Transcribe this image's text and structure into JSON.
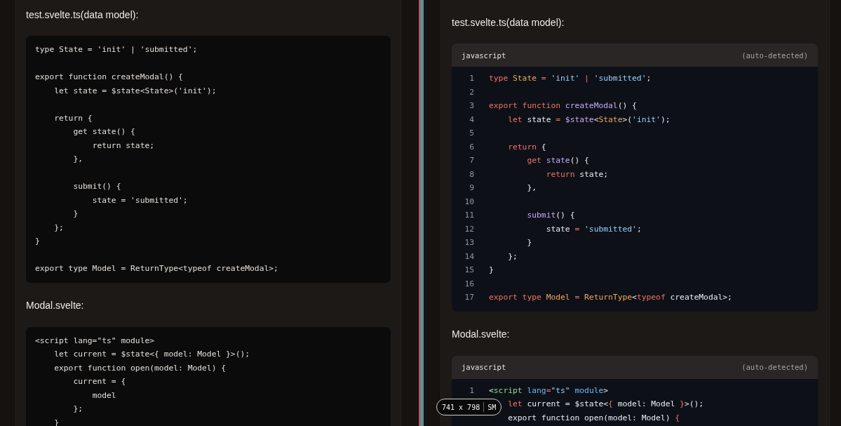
{
  "left_pane": {
    "sections": [
      {
        "heading": "test.svelte.ts(data model):",
        "code": {
          "paragraphs": [
            [
              "type State = 'init' | 'submitted';"
            ],
            [
              "export function createModal() {",
              "    let state = $state<State>('init');"
            ],
            [
              "    return {",
              "        get state() {",
              "            return state;",
              "        },"
            ],
            [
              "        submit() {",
              "            state = 'submitted';",
              "        }",
              "    };",
              "}"
            ],
            [
              "export type Model = ReturnType<typeof createModal>;"
            ]
          ]
        }
      },
      {
        "heading": "Modal.svelte:",
        "code": {
          "paragraphs": [
            [
              "<script lang=\"ts\" module>",
              "    let current = $state<{ model: Model }>();",
              "    export function open(model: Model) {",
              "        current = {",
              "            model",
              "        };",
              "    }"
            ]
          ]
        }
      }
    ]
  },
  "right_pane": {
    "sections": [
      {
        "heading": "test.svelte.ts(data model):",
        "code": {
          "language": "javascript",
          "detection": "(auto-detected)",
          "lines": [
            {
              "number": "1",
              "tokens": [
                {
                  "text": "type ",
                  "kind": "keyword"
                },
                {
                  "text": "State",
                  "kind": "type"
                },
                {
                  "text": " = ",
                  "kind": "operator"
                },
                {
                  "text": "'init'",
                  "kind": "string"
                },
                {
                  "text": " | ",
                  "kind": "operator"
                },
                {
                  "text": "'submitted'",
                  "kind": "string"
                },
                {
                  "text": ";"
                }
              ]
            },
            {
              "number": "2"
            },
            {
              "number": "3",
              "tokens": [
                {
                  "text": "export function ",
                  "kind": "keyword"
                },
                {
                  "text": "createModal",
                  "kind": "function"
                },
                {
                  "text": "() {"
                }
              ]
            },
            {
              "number": "4",
              "tokens": [
                {
                  "text": "    let",
                  "kind": "keyword"
                },
                {
                  "text": " state"
                },
                {
                  "text": " = ",
                  "kind": "operator"
                },
                {
                  "text": "$state",
                  "kind": "function"
                },
                {
                  "text": "<"
                },
                {
                  "text": "State",
                  "kind": "type"
                },
                {
                  "text": ">("
                },
                {
                  "text": "'init'",
                  "kind": "string"
                },
                {
                  "text": ");"
                }
              ]
            },
            {
              "number": "5"
            },
            {
              "number": "6",
              "tokens": [
                {
                  "text": "    return",
                  "kind": "keyword"
                },
                {
                  "text": " {"
                }
              ]
            },
            {
              "number": "7",
              "tokens": [
                {
                  "text": "        get ",
                  "kind": "keyword"
                },
                {
                  "text": "state",
                  "kind": "function"
                },
                {
                  "text": "() {"
                }
              ]
            },
            {
              "number": "8",
              "tokens": [
                {
                  "text": "            return",
                  "kind": "keyword"
                },
                {
                  "text": " state;"
                }
              ]
            },
            {
              "number": "9",
              "tokens": [
                {
                  "text": "        },"
                }
              ]
            },
            {
              "number": "10"
            },
            {
              "number": "11",
              "tokens": [
                {
                  "text": "        submit",
                  "kind": "function"
                },
                {
                  "text": "() {"
                }
              ]
            },
            {
              "number": "12",
              "tokens": [
                {
                  "text": "            state"
                },
                {
                  "text": " = ",
                  "kind": "operator"
                },
                {
                  "text": "'submitted'",
                  "kind": "string"
                },
                {
                  "text": ";"
                }
              ]
            },
            {
              "number": "13",
              "tokens": [
                {
                  "text": "        }"
                }
              ]
            },
            {
              "number": "14",
              "tokens": [
                {
                  "text": "    };"
                }
              ]
            },
            {
              "number": "15",
              "tokens": [
                {
                  "text": "}"
                }
              ]
            },
            {
              "number": "16"
            },
            {
              "number": "17",
              "tokens": [
                {
                  "text": "export type ",
                  "kind": "keyword"
                },
                {
                  "text": "Model",
                  "kind": "type"
                },
                {
                  "text": " = ",
                  "kind": "operator"
                },
                {
                  "text": "ReturnType",
                  "kind": "type"
                },
                {
                  "text": "<"
                },
                {
                  "text": "typeof",
                  "kind": "keyword"
                },
                {
                  "text": " createModal>;"
                }
              ]
            }
          ]
        }
      },
      {
        "heading": "Modal.svelte:",
        "code": {
          "language": "javascript",
          "detection": "(auto-detected)",
          "lines": [
            {
              "number": "1",
              "tokens": [
                {
                  "text": "<"
                },
                {
                  "text": "script",
                  "kind": "tag"
                },
                {
                  "text": " lang",
                  "kind": "attribute"
                },
                {
                  "text": "=",
                  "kind": "operator"
                },
                {
                  "text": "\"ts\"",
                  "kind": "string"
                },
                {
                  "text": " module",
                  "kind": "attribute"
                },
                {
                  "text": ">"
                }
              ]
            },
            {
              "tokens": [
                {
                  "text": "    let",
                  "kind": "keyword"
                },
                {
                  "text": " current = $state<"
                },
                {
                  "text": "{",
                  "kind": "operator"
                },
                {
                  "text": " model: Model "
                },
                {
                  "text": "}",
                  "kind": "operator"
                },
                {
                  "text": ">();"
                }
              ]
            },
            {
              "tokens": [
                {
                  "text": "    export function open(model: Model) "
                },
                {
                  "text": "{",
                  "kind": "operator"
                }
              ]
            }
          ]
        }
      }
    ]
  },
  "size_badge": {
    "size": "741 x 798",
    "breakpoint": "SM"
  }
}
